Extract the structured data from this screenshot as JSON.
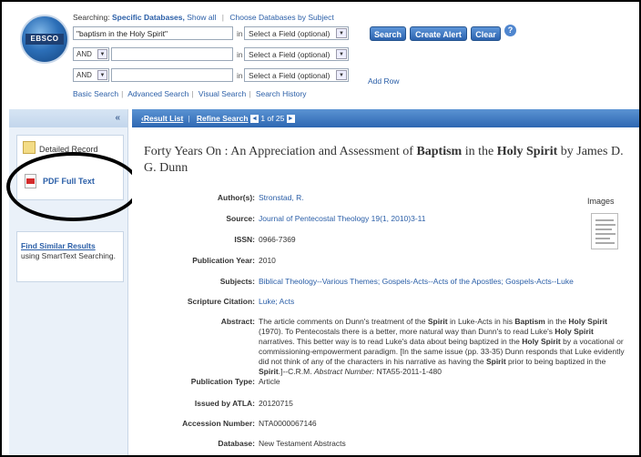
{
  "header": {
    "logo_text": "EBSCO",
    "searching_label": "Searching:",
    "searching_db": "Specific Databases,",
    "show_all": "Show all",
    "choose_db": "Choose Databases by Subject",
    "row1": {
      "query": "\"baptism in the Holy Spirit\"",
      "in_label": "in",
      "field": "Select a Field (optional)"
    },
    "row2": {
      "bool": "AND",
      "query": "",
      "in_label": "in",
      "field": "Select a Field (optional)"
    },
    "row3": {
      "bool": "AND",
      "query": "",
      "in_label": "in",
      "field": "Select a Field (optional)"
    },
    "search_btn": "Search",
    "alert_btn": "Create Alert",
    "clear_btn": "Clear",
    "help_glyph": "?",
    "add_row": "Add Row",
    "links": [
      "Basic Search",
      "Advanced Search",
      "Visual Search",
      "Search History"
    ]
  },
  "sidebar": {
    "collapse_glyph": "«",
    "format_label": "Detailed Record",
    "pdf_label": "PDF Full Text",
    "similar_link": "Find Similar Results",
    "similar_sub": "using SmartText Searching."
  },
  "main": {
    "result_list": "‹Result List",
    "refine": "Refine Search",
    "prev": "◄",
    "position": "1 of 25",
    "next": "►",
    "title_pre": "Forty Years On : An Appreciation and Assessment of ",
    "title_b1": "Baptism",
    "title_mid": " in the ",
    "title_b2": "Holy Spirit",
    "title_post": " by James D. G. Dunn",
    "images_label": "Images",
    "fields": {
      "author_label": "Author(s):",
      "author": "Stronstad, R.",
      "source_label": "Source:",
      "source": "Journal of Pentecostal Theology 19(1, 2010)3-11",
      "issn_label": "ISSN:",
      "issn": "0966-7369",
      "year_label": "Publication Year:",
      "year": "2010",
      "subjects_label": "Subjects:",
      "subjects": "Biblical Theology--Various Themes; Gospels-Acts--Acts of the Apostles; Gospels-Acts--Luke",
      "scripture_label": "Scripture Citation:",
      "scripture": "Luke; Acts",
      "abstract_label": "Abstract:",
      "abstract_parts": {
        "p1": "The article comments on Dunn's treatment of the ",
        "b1": "Spirit",
        "p2": " in Luke-Acts in his ",
        "b2": "Baptism",
        "p3": " in the ",
        "b3": "Holy Spirit",
        "p4": " (1970). To Pentecostals there is a better, more natural way than Dunn's to read Luke's ",
        "b4": "Holy Spirit",
        "p5": " narratives. This better way is to read Luke's data about being baptized in the ",
        "b5": "Holy Spirit",
        "p6": " by a vocational or commissioning-empowerment paradigm. [In the same issue (pp. 33-35) Dunn responds that Luke evidently did not think of any of the characters in his narrative as having the ",
        "b6": "Spirit",
        "p7": " prior to being baptized in the ",
        "b7": "Spirit",
        "p8": ".]--C.R.M. ",
        "i1": "Abstract Number:",
        "p9": " NTA55-2011-1-480"
      },
      "pubtype_label": "Publication Type:",
      "pubtype": "Article",
      "issued_label": "Issued by ATLA:",
      "issued": "20120715",
      "accession_label": "Accession Number:",
      "accession": "NTA0000067146",
      "database_label": "Database:",
      "database": "New Testament Abstracts"
    }
  }
}
